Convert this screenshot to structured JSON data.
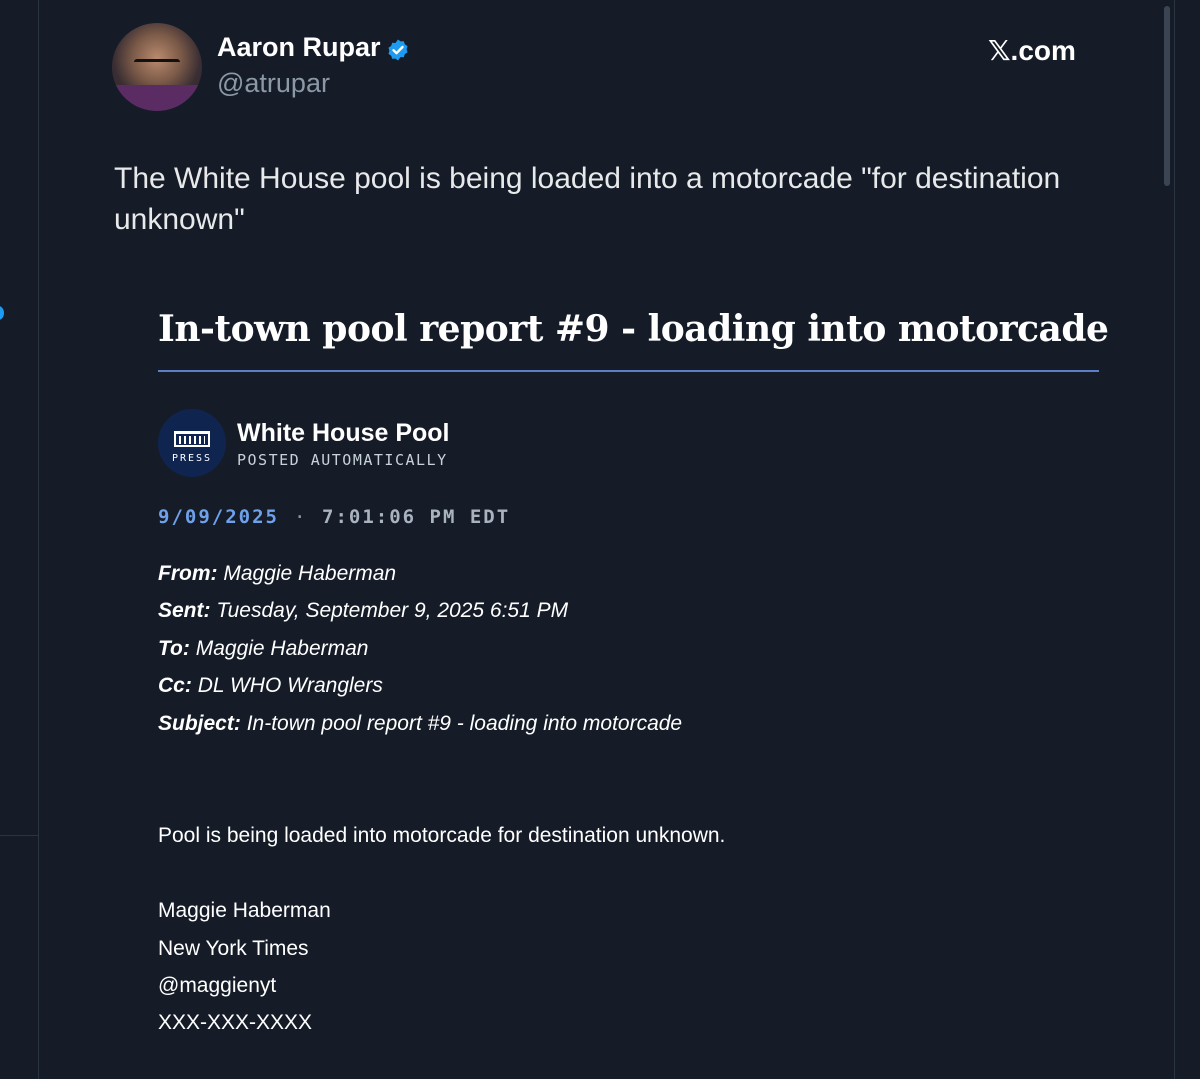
{
  "tweet": {
    "author_name": "Aaron Rupar",
    "handle": "@atrupar",
    "brand": "𝕏.com",
    "text": "The White House pool is being loaded into a motorcade \"for destination unknown\""
  },
  "report": {
    "title": "In-town pool report #9 - loading into motorcade",
    "source_name": "White House Pool",
    "source_sub": "POSTED AUTOMATICALLY",
    "logo_text": "PRESS",
    "date": "9/09/2025",
    "separator": "·",
    "time": "7:01:06 PM EDT",
    "headers": [
      {
        "label": "From:",
        "value": "Maggie Haberman"
      },
      {
        "label": "Sent:",
        "value": "Tuesday, September 9, 2025 6:51 PM"
      },
      {
        "label": "To:",
        "value": "Maggie Haberman"
      },
      {
        "label": "Cc:",
        "value": "DL WHO Wranglers"
      },
      {
        "label": "Subject:",
        "value": "In-town pool report #9 - loading into motorcade"
      }
    ],
    "body": "Pool is being loaded into motorcade for destination unknown.",
    "signature": [
      "Maggie Haberman",
      "New York Times",
      "@maggienyt",
      "XXX-XXX-XXXX"
    ]
  }
}
